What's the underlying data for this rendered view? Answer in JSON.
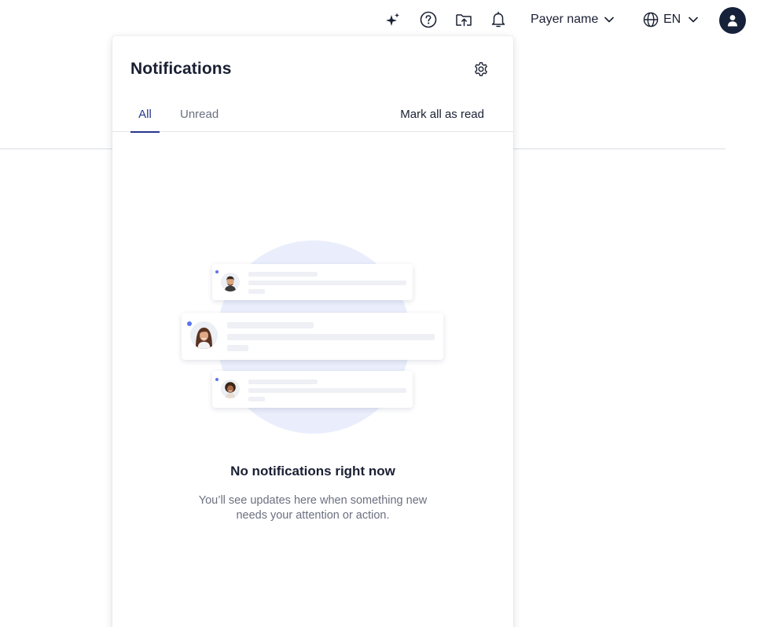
{
  "topbar": {
    "icons": [
      "sparkle-icon",
      "help-icon",
      "folder-upload-icon",
      "bell-icon"
    ],
    "payer_name": "Payer name",
    "language": "EN"
  },
  "notifications": {
    "title": "Notifications",
    "tabs": [
      {
        "label": "All",
        "active": true
      },
      {
        "label": "Unread",
        "active": false
      }
    ],
    "mark_all_label": "Mark all as read",
    "empty_title": "No notifications right now",
    "empty_description": "You’ll see updates here when something new needs your attention or action."
  },
  "colors": {
    "accent": "#27378f",
    "unread_dot": "#5d74f0",
    "illustration_circle": "#eaeefc",
    "avatar_bg": "#16213a"
  }
}
